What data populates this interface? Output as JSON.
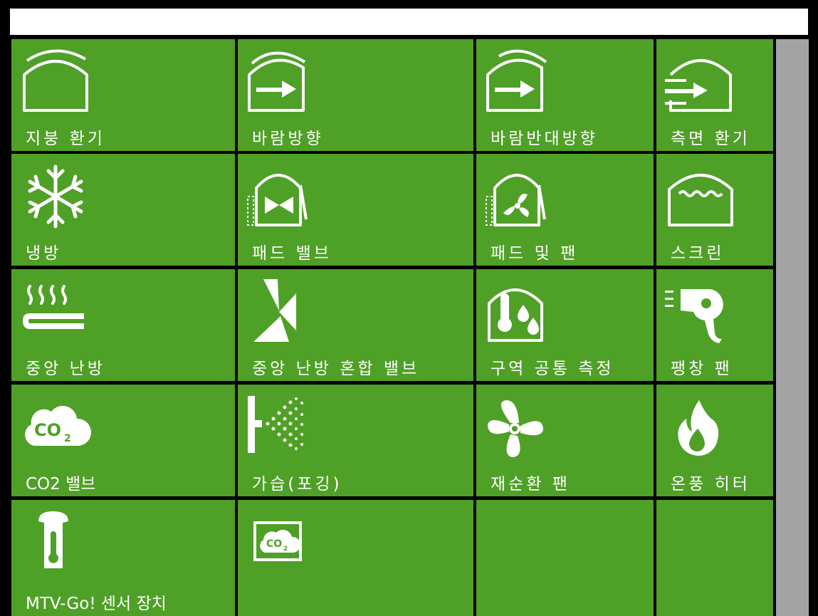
{
  "colors": {
    "tile": "#4fa027",
    "frame": "#000000",
    "scrollbar": "#a3a3a3",
    "header": "#ffffff"
  },
  "tiles": [
    {
      "label": "지붕 환기",
      "icon": "roof-vent-icon"
    },
    {
      "label": "바람방향",
      "icon": "wind-direction-icon"
    },
    {
      "label": "바람반대방향",
      "icon": "wind-opposite-icon"
    },
    {
      "label": "측면 환기",
      "icon": "side-vent-icon"
    },
    {
      "label": "냉방",
      "icon": "snowflake-icon"
    },
    {
      "label": "패드 밸브",
      "icon": "pad-valve-icon"
    },
    {
      "label": "패드 및 팬",
      "icon": "pad-fan-icon"
    },
    {
      "label": "스크린",
      "icon": "screen-icon"
    },
    {
      "label": "중앙 난방",
      "icon": "central-heating-icon"
    },
    {
      "label": "중앙 난방 혼합 밸브",
      "icon": "mixing-valve-icon"
    },
    {
      "label": "구역 공통 측정",
      "icon": "zone-measurement-icon"
    },
    {
      "label": "팽창 팬",
      "icon": "expansion-fan-icon"
    },
    {
      "label": "CO2 밸브",
      "icon": "co2-cloud-icon"
    },
    {
      "label": "가습(포깅)",
      "icon": "fogging-spray-icon"
    },
    {
      "label": "재순환 팬",
      "icon": "recirculation-fan-icon"
    },
    {
      "label": "온풍 히터",
      "icon": "flame-icon"
    },
    {
      "label": "MTV-Go! 센서 장치",
      "icon": "sensor-box-icon"
    },
    {
      "label": "",
      "icon": "co2-box-icon"
    },
    {
      "label": "",
      "icon": ""
    },
    {
      "label": "",
      "icon": ""
    }
  ]
}
